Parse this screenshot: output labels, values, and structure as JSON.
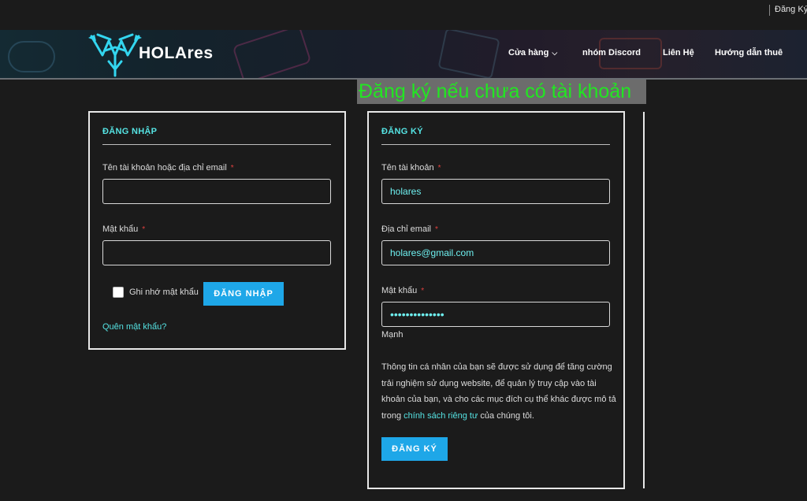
{
  "topbar": {
    "register_link": "Đăng Ký"
  },
  "header": {
    "brand": "HOLAres",
    "nav": [
      {
        "label": "Cửa hàng",
        "has_dropdown": true
      },
      {
        "label": "nhóm Discord",
        "has_dropdown": false
      },
      {
        "label": "Liên Hệ",
        "has_dropdown": false
      },
      {
        "label": "Hướng dẫn thuê",
        "has_dropdown": false
      }
    ]
  },
  "banner": {
    "text": "Đăng ký nếu chưa có tài khoản",
    "color": "#22e622"
  },
  "login": {
    "title": "ĐĂNG NHẬP",
    "username_label": "Tên tài khoản hoặc địa chỉ email",
    "username_value": "",
    "password_label": "Mật khẩu",
    "password_value": "",
    "remember_label": "Ghi nhớ mật khẩu",
    "submit_label": "ĐĂNG NHẬP",
    "forgot_label": "Quên mật khẩu?"
  },
  "register": {
    "title": "ĐĂNG KÝ",
    "username_label": "Tên tài khoản",
    "username_value": "holares",
    "email_label": "Địa chỉ email",
    "email_value": "holares@gmail.com",
    "password_label": "Mật khẩu",
    "password_masked": "••••••••••••••",
    "strength_label": "Mạnh",
    "privacy_before": "Thông tin cá nhân của bạn sẽ được sử dụng để tăng cường trải nghiệm sử dụng website, để quản lý truy cập vào tài khoản của bạn, và cho các mục đích cụ thể khác được mô tả trong ",
    "privacy_link": "chính sách riêng tư",
    "privacy_after": " của chúng tôi.",
    "submit_label": "ĐĂNG KÝ"
  },
  "required_marker": "*",
  "colors": {
    "accent": "#1ea7e8",
    "heading": "#55e3e3",
    "required": "#e0413f",
    "background": "#1b1b1b"
  }
}
